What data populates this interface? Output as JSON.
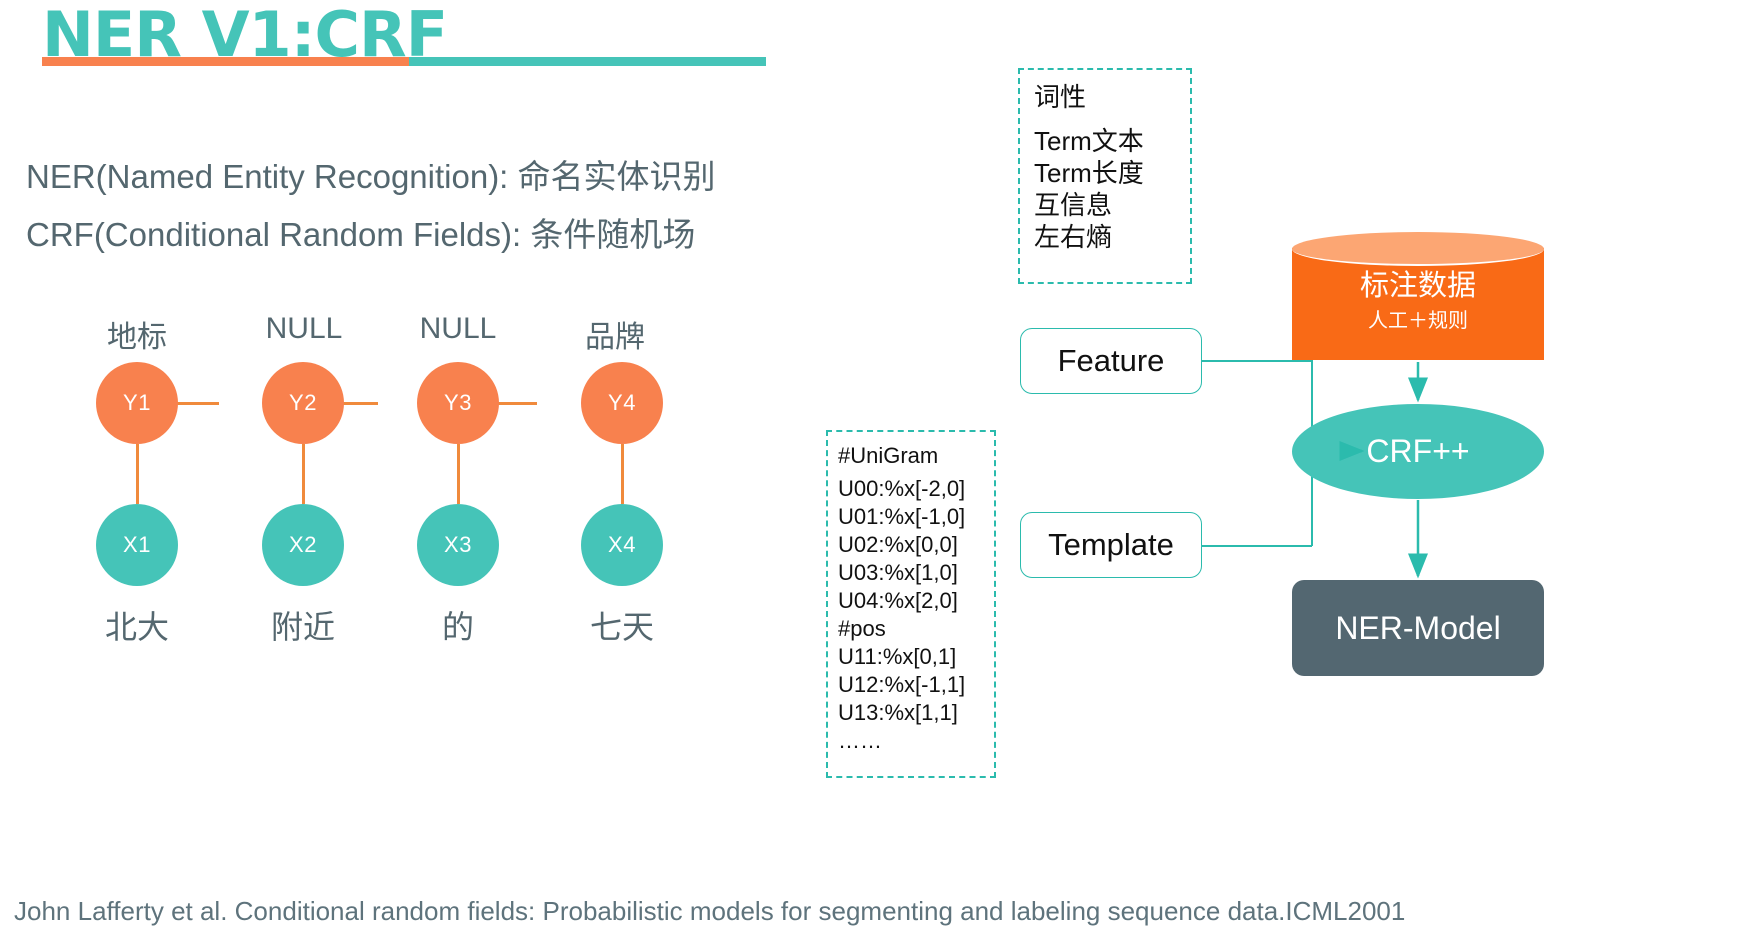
{
  "slide": {
    "title": "NER V1:CRF",
    "definitions": [
      "NER(Named Entity Recognition): 命名实体识别",
      "CRF(Conditional Random Fields): 条件随机场"
    ],
    "citation": "John Lafferty et al. Conditional random fields: Probabilistic models for segmenting and labeling sequence data.ICML2001"
  },
  "crf_graph": {
    "tags": [
      "地标",
      "NULL",
      "NULL",
      "品牌"
    ],
    "y_nodes": [
      "Y1",
      "Y2",
      "Y3",
      "Y4"
    ],
    "x_nodes": [
      "X1",
      "X2",
      "X3",
      "X4"
    ],
    "words": [
      "北大",
      "附近",
      "的",
      "七天"
    ]
  },
  "feature_list": {
    "items": [
      "词性",
      "Term文本",
      "Term长度",
      "互信息",
      "左右熵"
    ]
  },
  "template_list": {
    "lines": [
      "#UniGram",
      "U00:%x[-2,0]",
      "U01:%x[-1,0]",
      "U02:%x[0,0]",
      "U03:%x[1,0]",
      "U04:%x[2,0]",
      "#pos",
      "U11:%x[0,1]",
      "U12:%x[-1,1]",
      "U13:%x[1,1]",
      "……"
    ]
  },
  "pipeline": {
    "feature_box": "Feature",
    "template_box": "Template",
    "datastore_title": "标注数据",
    "datastore_sub": "人工＋规则",
    "trainer": "CRF++",
    "output_model": "NER-Model"
  },
  "colors": {
    "teal": "#45C4B8",
    "teal_line": "#2BBBAD",
    "orange": "#F8814E",
    "orange_deep": "#F96A16",
    "orange_light": "#FCA673",
    "slate": "#536771",
    "text_slate": "#54676F"
  }
}
